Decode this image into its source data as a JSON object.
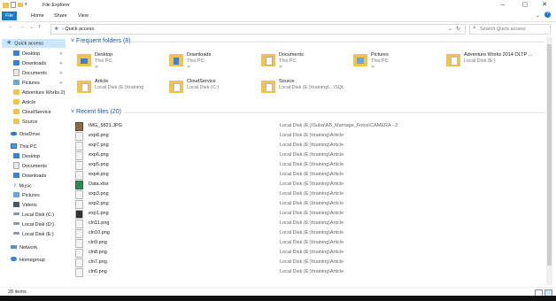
{
  "window": {
    "title": "File Explorer",
    "min": "–",
    "max": "▢",
    "close": "✕"
  },
  "ribbon": {
    "tabs": [
      "File",
      "Home",
      "Share",
      "View"
    ],
    "help": "?"
  },
  "address": {
    "back": "←",
    "forward": "→",
    "dropdown": "⌄",
    "up": "↑",
    "path_root": "›",
    "breadcrumb": "Quick access",
    "refresh": "↻"
  },
  "search": {
    "placeholder": "Search Quick access"
  },
  "sidebar": {
    "items": [
      {
        "label": "Quick access",
        "icon": "star-icon",
        "selected": true
      },
      {
        "label": "Desktop",
        "icon": "desktop-folder-icon",
        "pinned": true
      },
      {
        "label": "Downloads",
        "icon": "downloads-folder-icon",
        "pinned": true
      },
      {
        "label": "Documents",
        "icon": "documents-folder-icon",
        "pinned": true
      },
      {
        "label": "Pictures",
        "icon": "pictures-folder-icon",
        "pinned": true
      },
      {
        "label": "Adventure Works 2(",
        "icon": "folder-icon"
      },
      {
        "label": "Article",
        "icon": "folder-icon"
      },
      {
        "label": "CloudService",
        "icon": "folder-icon"
      },
      {
        "label": "Source",
        "icon": "folder-icon"
      },
      {
        "label": "OneDrive",
        "icon": "onedrive-icon"
      },
      {
        "label": "This PC",
        "icon": "computer-icon"
      },
      {
        "label": "Desktop",
        "icon": "desktop-folder-icon"
      },
      {
        "label": "Documents",
        "icon": "documents-folder-icon"
      },
      {
        "label": "Downloads",
        "icon": "downloads-folder-icon"
      },
      {
        "label": "Music",
        "icon": "music-icon"
      },
      {
        "label": "Pictures",
        "icon": "pictures-folder-icon"
      },
      {
        "label": "Videos",
        "icon": "videos-icon"
      },
      {
        "label": "Local Disk (C:)",
        "icon": "drive-icon"
      },
      {
        "label": "Local Disk (D:)",
        "icon": "drive-icon"
      },
      {
        "label": "Local Disk (E:)",
        "icon": "drive-icon"
      },
      {
        "label": "Network",
        "icon": "network-icon"
      },
      {
        "label": "Homegroup",
        "icon": "homegroup-icon"
      }
    ]
  },
  "frequent": {
    "header": "Frequent folders (8)",
    "tiles": [
      {
        "name": "Desktop",
        "sub": "This PC",
        "pin": "✈"
      },
      {
        "name": "Downloads",
        "sub": "This PC",
        "pin": "✈"
      },
      {
        "name": "Documents",
        "sub": "This PC",
        "pin": "✈"
      },
      {
        "name": "Pictures",
        "sub": "This PC",
        "pin": "✈"
      },
      {
        "name": "Adventure Works 2014 OLTP ...",
        "sub": "Local Disk (E:)",
        "pin": ""
      },
      {
        "name": "Article",
        "sub": "Local Disk (E:)\\training",
        "pin": ""
      },
      {
        "name": "CloudService",
        "sub": "Local Disk (C:)",
        "pin": ""
      },
      {
        "name": "Source",
        "sub": "Local Disk (E:)\\training\\...\\SQL",
        "pin": ""
      }
    ]
  },
  "recent": {
    "header": "Recent files (20)",
    "files": [
      {
        "name": "IMG_5821.JPG",
        "location": "Local Disk (E:)\\Suba\\AB_Marriage_Fotos\\CAMERA - 2"
      },
      {
        "name": "exp8.png",
        "location": "Local Disk (E:)\\training\\Article"
      },
      {
        "name": "exp7.png",
        "location": "Local Disk (E:)\\training\\Article"
      },
      {
        "name": "exp6.png",
        "location": "Local Disk (E:)\\training\\Article"
      },
      {
        "name": "exp5.png",
        "location": "Local Disk (E:)\\training\\Article"
      },
      {
        "name": "exp4.png",
        "location": "Local Disk (E:)\\training\\Article"
      },
      {
        "name": "Data.xlsx",
        "location": "Local Disk (E:)\\training\\Article"
      },
      {
        "name": "exp3.png",
        "location": "Local Disk (E:)\\training\\Article"
      },
      {
        "name": "exp2.png",
        "location": "Local Disk (E:)\\training\\Article"
      },
      {
        "name": "exp1.png",
        "location": "Local Disk (E:)\\training\\Article"
      },
      {
        "name": "cln11.png",
        "location": "Local Disk (E:)\\training\\Article"
      },
      {
        "name": "cln10.png",
        "location": "Local Disk (E:)\\training\\Article"
      },
      {
        "name": "cln9.png",
        "location": "Local Disk (E:)\\training\\Article"
      },
      {
        "name": "cln8.png",
        "location": "Local Disk (E:)\\training\\Article"
      },
      {
        "name": "cln7.png",
        "location": "Local Disk (E:)\\training\\Article"
      },
      {
        "name": "cln6.png",
        "location": "Local Disk (E:)\\training\\Article"
      }
    ]
  },
  "status": {
    "items": "28 items"
  },
  "colors": {
    "accent": "#1979ca",
    "selected": "#cce8ff",
    "folder": "#f2c44f",
    "header_text": "#1e5aa8"
  }
}
